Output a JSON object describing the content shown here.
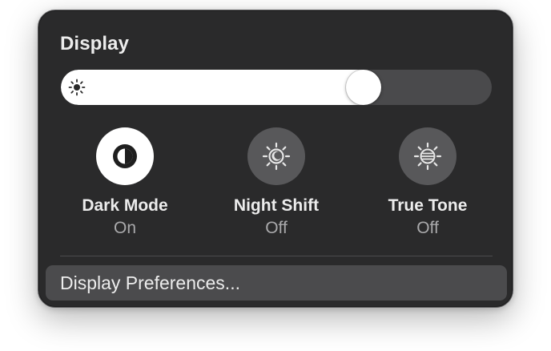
{
  "panel": {
    "title": "Display"
  },
  "brightness": {
    "level": 0.72,
    "icon": "sun-icon"
  },
  "toggles": [
    {
      "label": "Dark Mode",
      "state": "On",
      "icon": "dark-mode-icon"
    },
    {
      "label": "Night Shift",
      "state": "Off",
      "icon": "night-shift-icon"
    },
    {
      "label": "True Tone",
      "state": "Off",
      "icon": "true-tone-icon"
    }
  ],
  "footer": {
    "preferences_label": "Display Preferences..."
  },
  "colors": {
    "panel_bg": "#2a2a2b",
    "toggle_on_bg": "#ffffff",
    "toggle_off_bg": "#58585a",
    "highlight_row": "#4b4b4d"
  }
}
